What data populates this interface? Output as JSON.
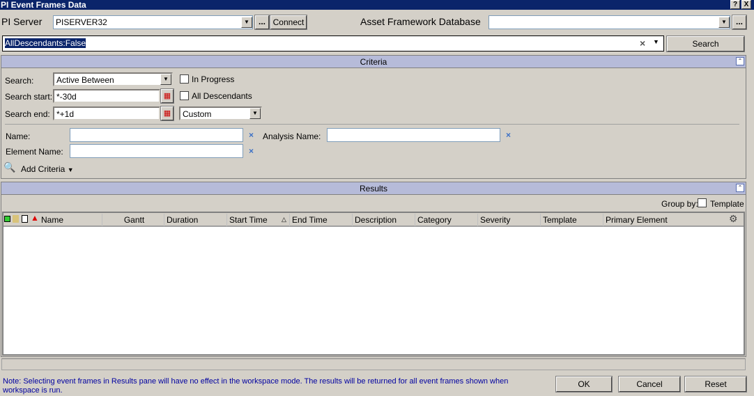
{
  "window": {
    "title": "PI Event Frames Data",
    "help": "?",
    "close": "X"
  },
  "server": {
    "label": "PI Server",
    "value": "PISERVER32",
    "browse": "...",
    "connect": "Connect",
    "af_label": "Asset Framework Database",
    "af_value": "",
    "af_browse": "..."
  },
  "query": {
    "value": "AllDescendants:False",
    "clear": "×",
    "search": "Search"
  },
  "criteria": {
    "title": "Criteria",
    "search_label": "Search:",
    "search_value": "Active Between",
    "in_progress": "In Progress",
    "start_label": "Search start:",
    "start_value": "*-30d",
    "all_desc": "All Descendants",
    "end_label": "Search end:",
    "end_value": "*+1d",
    "custom": "Custom",
    "name_label": "Name:",
    "analysis_label": "Analysis Name:",
    "element_label": "Element Name:",
    "add_criteria": "Add Criteria",
    "x": "×"
  },
  "results": {
    "title": "Results",
    "group_by": "Group by:",
    "template": "Template",
    "columns": [
      "Name",
      "Gantt",
      "Duration",
      "Start Time",
      "End Time",
      "Description",
      "Category",
      "Severity",
      "Template",
      "Primary Element"
    ]
  },
  "footer": {
    "note": "Note: Selecting event frames in Results pane will have no effect in the workspace mode. The results will be returned for all event frames shown when workspace is run.",
    "ok": "OK",
    "cancel": "Cancel",
    "reset": "Reset"
  },
  "colors": {
    "title": "#0a246a",
    "band": "#b6bbd9",
    "note": "#0000a0"
  }
}
